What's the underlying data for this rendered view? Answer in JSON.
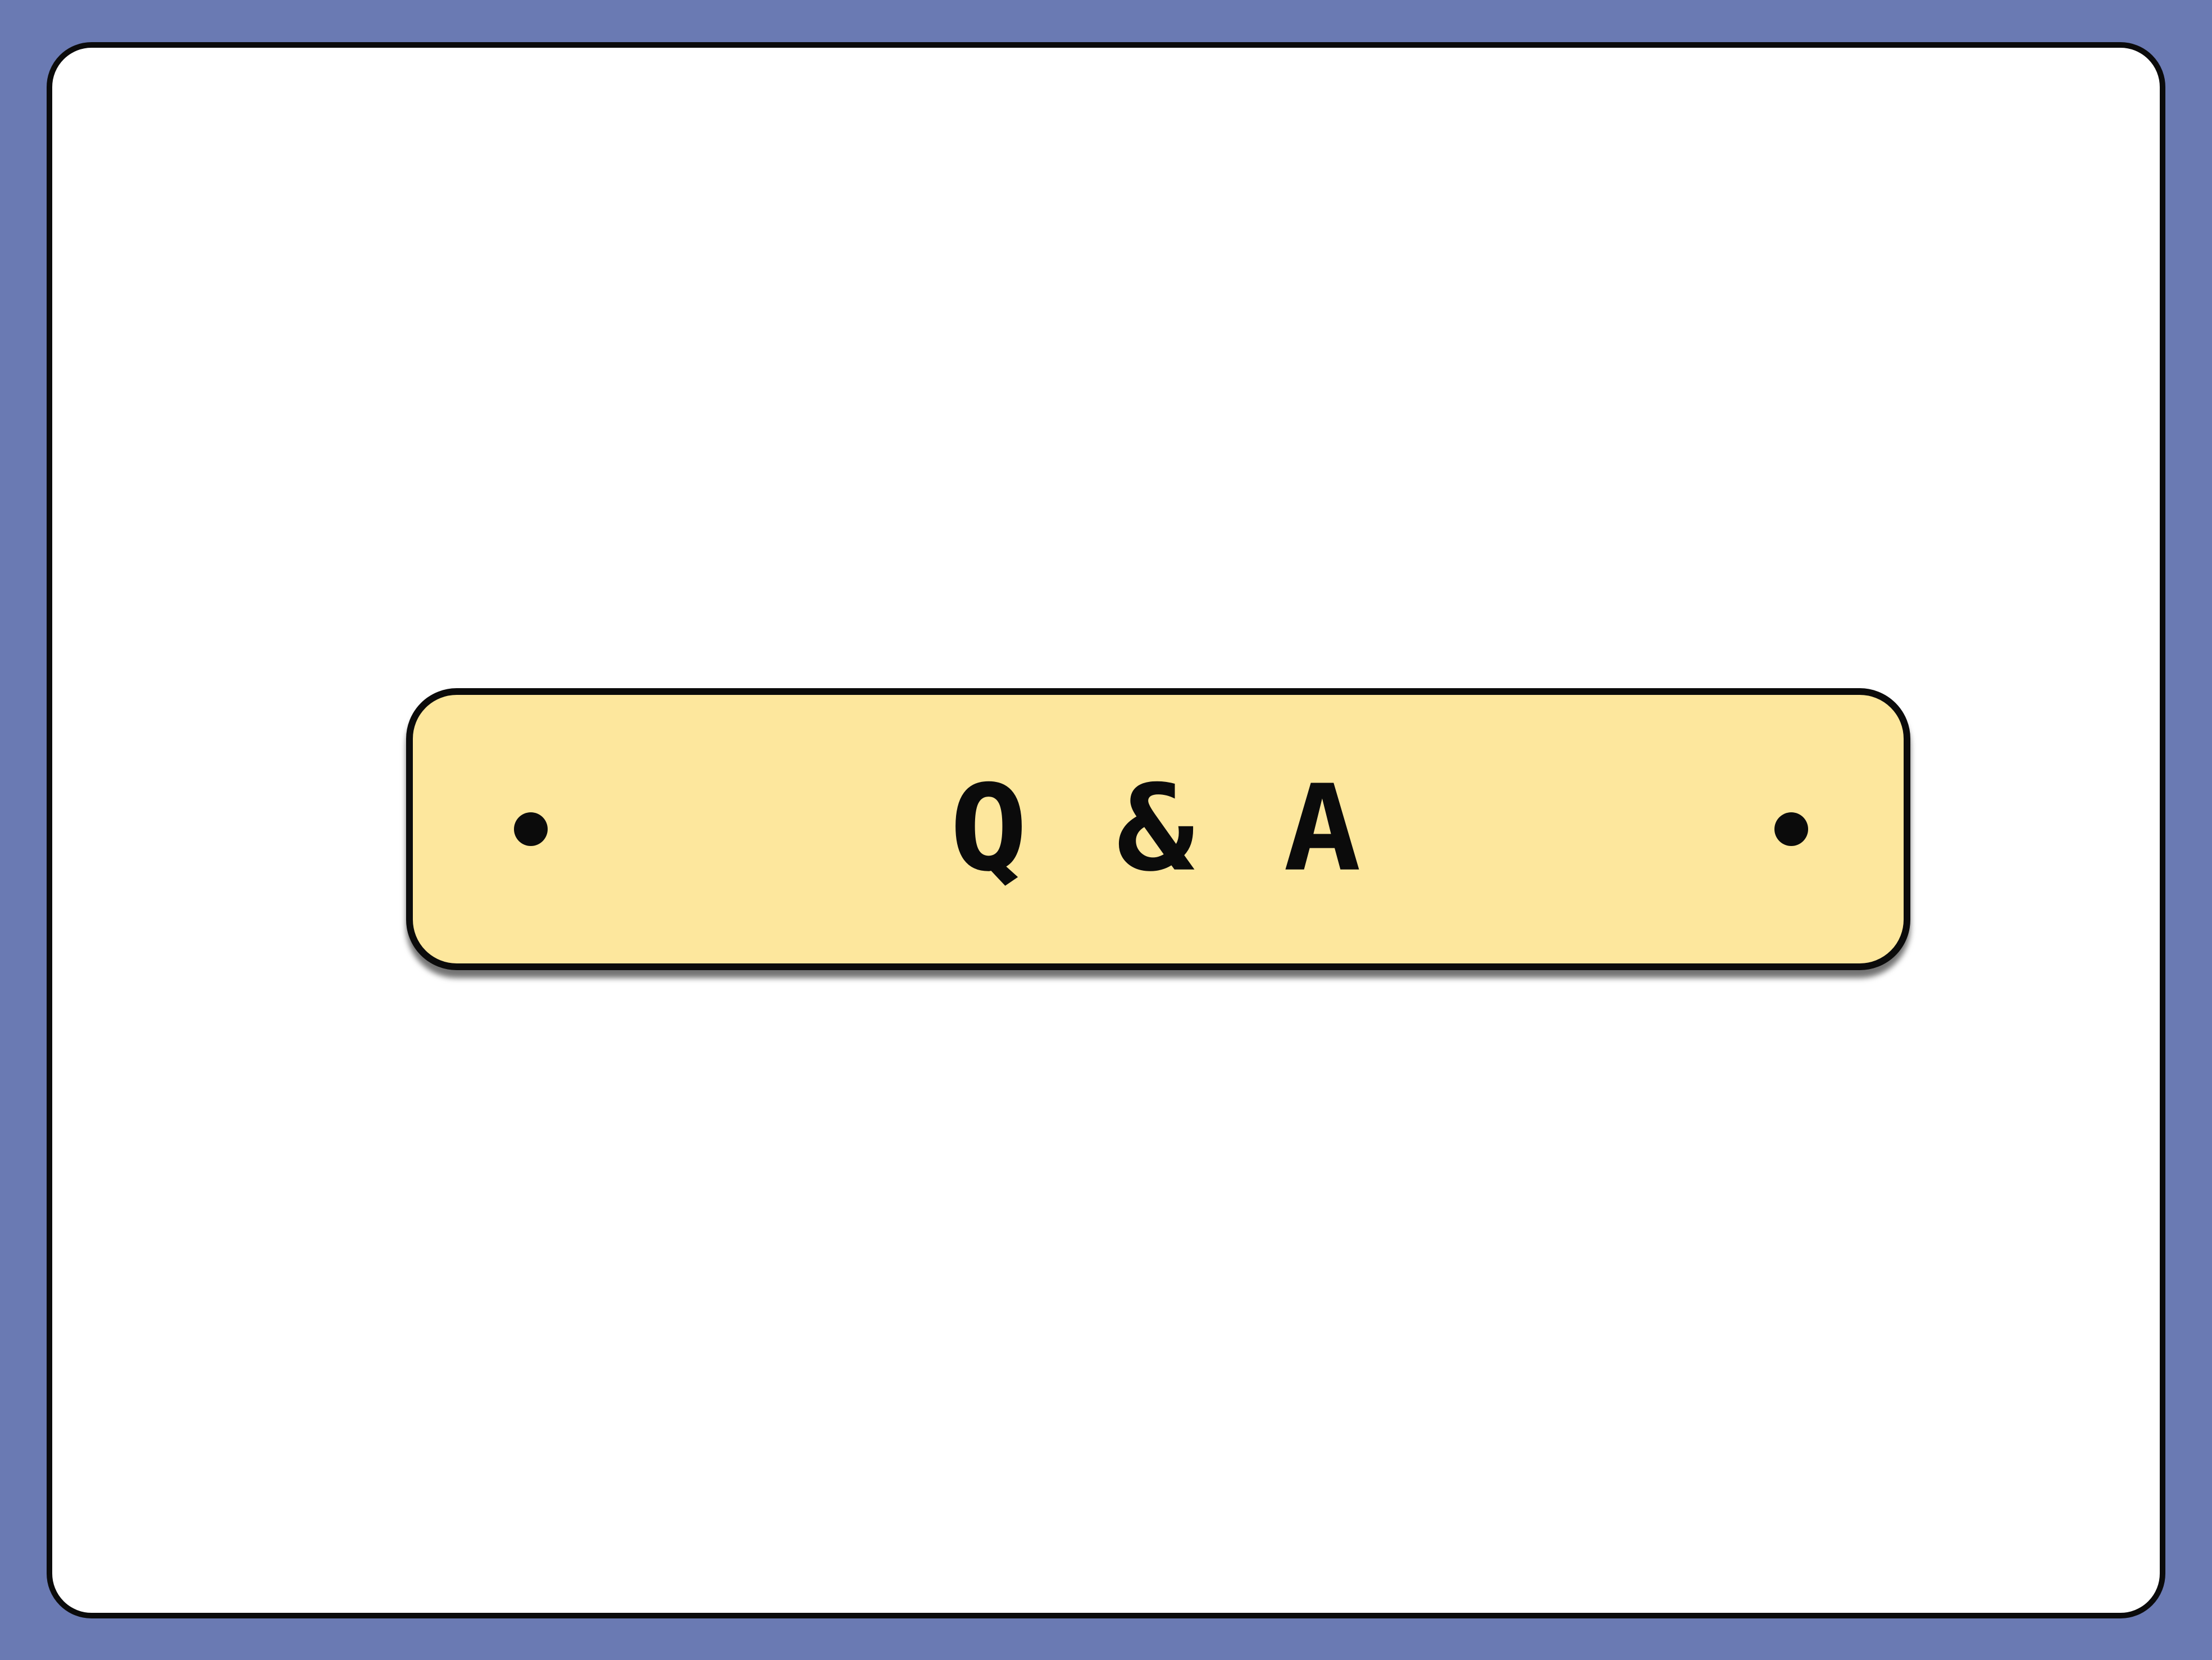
{
  "slide": {
    "title": "Q & A",
    "background_color": "#6a7ab3",
    "card_color": "#ffffff",
    "banner_color": "#fde79d",
    "border_color": "#0b0b0b"
  },
  "icons": {
    "left_dot": "dot-icon",
    "right_dot": "dot-icon"
  }
}
